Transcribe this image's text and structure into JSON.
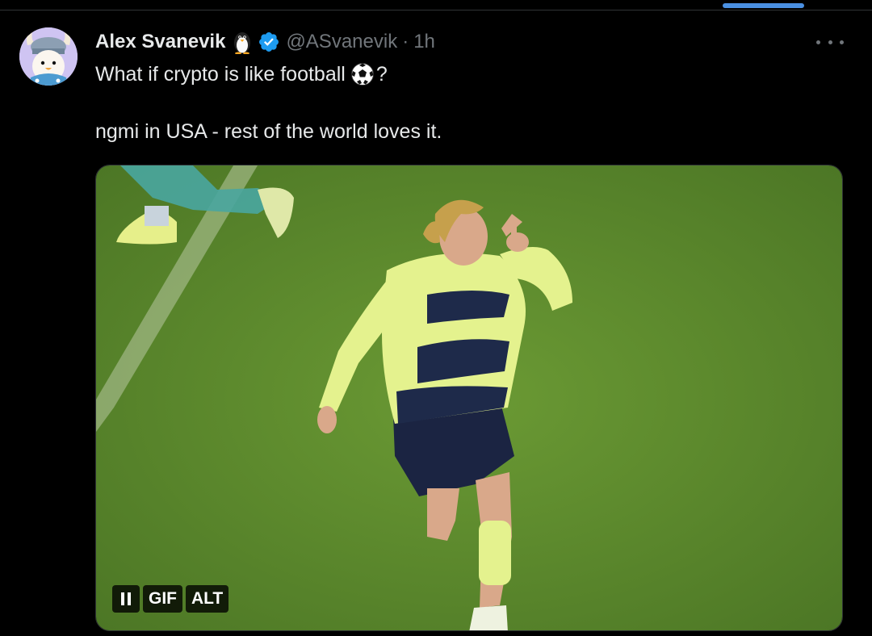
{
  "tweet": {
    "author": {
      "display_name": "Alex Svanevik",
      "handle": "@ASvanevik",
      "verified": true,
      "name_emoji": "penguin"
    },
    "separator": "·",
    "timestamp": "1h",
    "text_line1_before": "What if crypto is like football",
    "text_line1_emoji": "soccer-ball",
    "text_line1_after": "?",
    "text_line2": "ngmi in USA - rest of the world loves it.",
    "media": {
      "type": "gif",
      "pause_label": "II",
      "gif_badge": "GIF",
      "alt_badge": "ALT",
      "description_colors": {
        "pitch": "#5e8a2c",
        "jersey": "#e4f28e",
        "stripes": "#1e2a4a"
      }
    }
  },
  "colors": {
    "background": "#000000",
    "primary_text": "#e7e9ea",
    "secondary_text": "#71767b",
    "verified": "#1d9bf0",
    "accent_bar": "#4a90e2"
  }
}
